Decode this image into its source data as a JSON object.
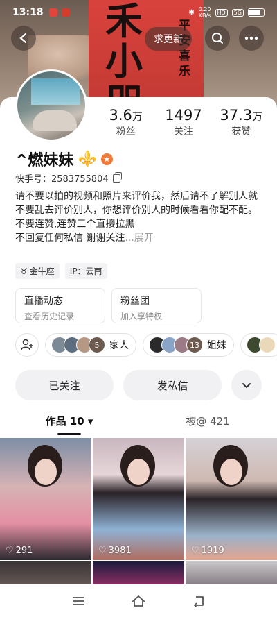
{
  "status_bar": {
    "time": "13:18",
    "net_speed": "0.20",
    "net_unit": "KB/s",
    "hd": "HD",
    "signal": "5G"
  },
  "banner": {
    "big_chars": [
      "禾",
      "小",
      "咫"
    ],
    "side_text": "平安喜乐",
    "update_label": "求更新"
  },
  "profile": {
    "stats": [
      {
        "value": "3.6",
        "unit": "万",
        "label": "粉丝"
      },
      {
        "value": "1497",
        "unit": "",
        "label": "关注"
      },
      {
        "value": "37.3",
        "unit": "万",
        "label": "获赞"
      }
    ],
    "name": "^燃妹妹",
    "fleur": "⚜️",
    "kuaishou_id_label": "快手号：",
    "kuaishou_id": "2583755804",
    "bio_lines": [
      "请不要以拍的视频和照片来评价我，然后请不了解别人就不要乱去评价别人，你想评价别人的时候看看你配不配。",
      "不要连赞,连赞三个直接拉黑",
      "不回复任何私信 谢谢关注"
    ],
    "bio_expand": "...展开",
    "tags": [
      "金牛座",
      "IP：云南"
    ]
  },
  "features": [
    {
      "title": "直播动态",
      "subtitle": "查看历史记录"
    },
    {
      "title": "粉丝团",
      "subtitle": "加入享特权"
    }
  ],
  "groups": [
    {
      "count": "5",
      "label": "家人"
    },
    {
      "count": "13",
      "label": "姐妹"
    }
  ],
  "actions": {
    "follow": "已关注",
    "message": "发私信"
  },
  "tabs": {
    "works": "作品 10",
    "liked": "被@ 421"
  },
  "videos": [
    {
      "likes": "291"
    },
    {
      "likes": "3981"
    },
    {
      "likes": "1919"
    }
  ],
  "colors": {
    "accent_orange": "#f07a3a",
    "banner_red": "#d9423c"
  }
}
